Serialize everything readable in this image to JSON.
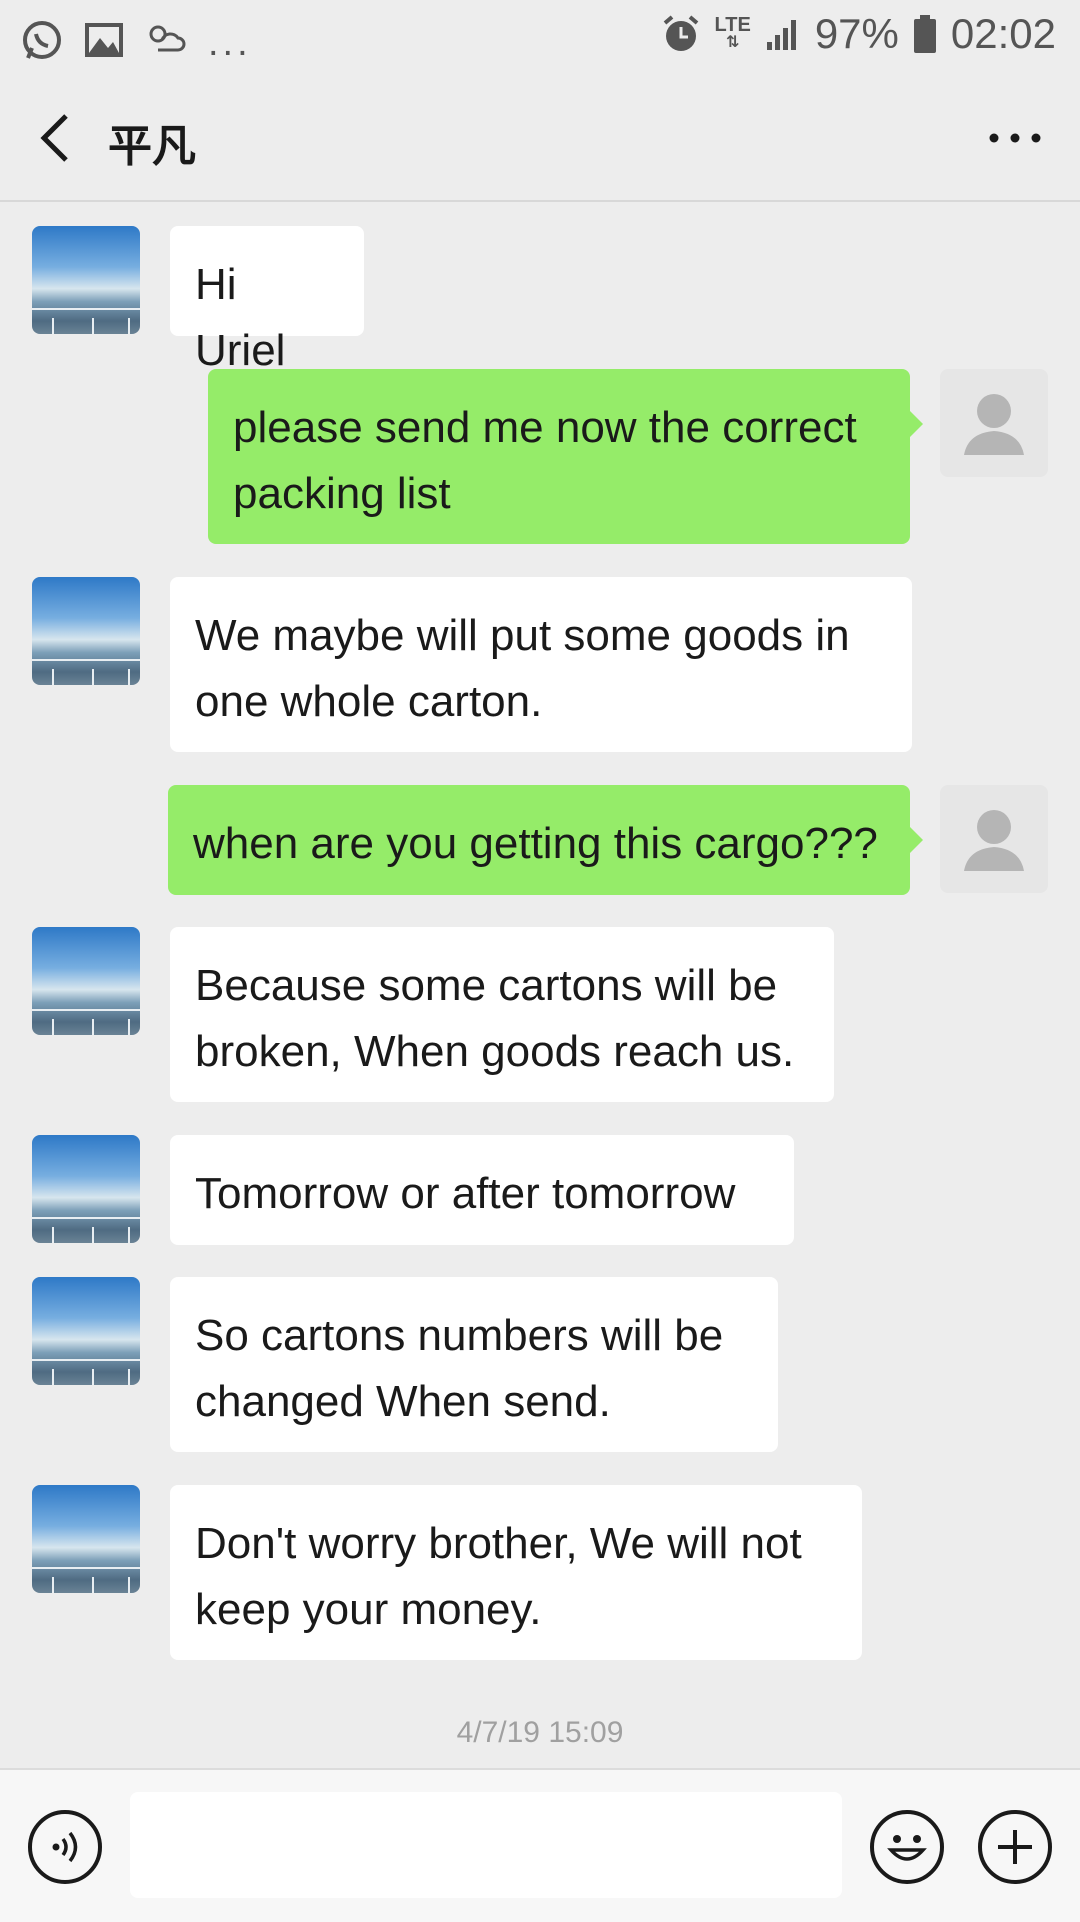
{
  "status_bar": {
    "battery": "97%",
    "time": "02:02",
    "network": "LTE",
    "more": "..."
  },
  "header": {
    "title": "平凡"
  },
  "messages": [
    {
      "from": "contact",
      "text": "Hi Uriel"
    },
    {
      "from": "me",
      "text": "please send me now the correct packing list"
    },
    {
      "from": "contact",
      "text": "We maybe will put some goods in one whole carton."
    },
    {
      "from": "me",
      "text": "when are you getting this cargo???"
    },
    {
      "from": "contact",
      "text": "Because some cartons will be broken, When goods reach us."
    },
    {
      "from": "contact",
      "text": "Tomorrow or after tomorrow"
    },
    {
      "from": "contact",
      "text": "So cartons numbers will be changed When send."
    },
    {
      "from": "contact",
      "text": "Don't worry brother, We will not keep your money."
    }
  ],
  "timestamp": "4/7/19 15:09",
  "icons": {
    "back": "back-chevron-icon",
    "more": "more-dots-icon",
    "voice": "voice-icon",
    "emoji": "emoji-icon",
    "plus": "plus-icon"
  },
  "colors": {
    "incoming_bubble": "#ffffff",
    "outgoing_bubble": "#95ec69",
    "background": "#ededed"
  }
}
